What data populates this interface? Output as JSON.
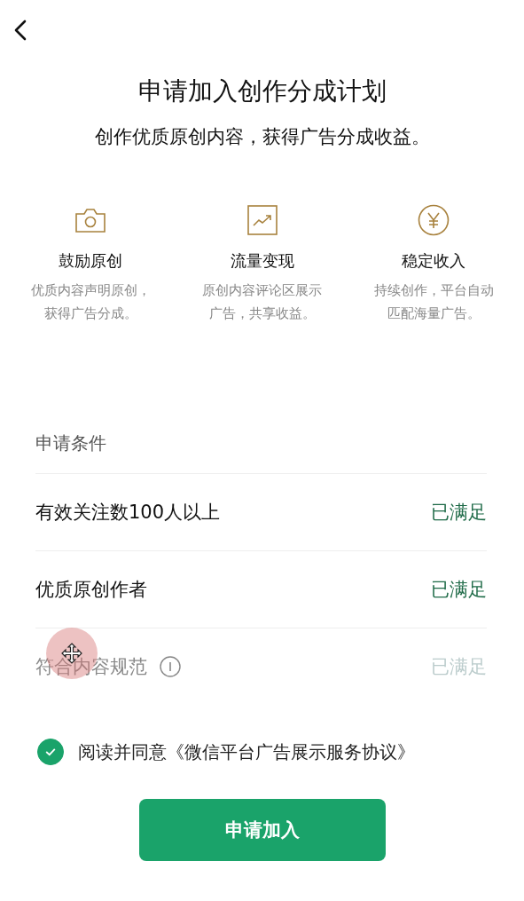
{
  "title": "申请加入创作分成计划",
  "subtitle": "创作优质原创内容，获得广告分成收益。",
  "features": [
    {
      "kind": "camera",
      "title": "鼓励原创",
      "desc": "优质内容声明原创，获得广告分成。"
    },
    {
      "kind": "chart",
      "title": "流量变现",
      "desc": "原创内容评论区展示广告，共享收益。"
    },
    {
      "kind": "yen",
      "title": "稳定收入",
      "desc": "持续创作，平台自动匹配海量广告。"
    }
  ],
  "conditions": {
    "heading": "申请条件",
    "rows": [
      {
        "label": "有效关注数100人以上",
        "status": "已满足",
        "info": false,
        "dimmed": false
      },
      {
        "label": "优质原创作者",
        "status": "已满足",
        "info": false,
        "dimmed": false
      },
      {
        "label": "符合内容规范",
        "status": "已满足",
        "info": true,
        "dimmed": true
      }
    ]
  },
  "agreement": {
    "checked": true,
    "text": "阅读并同意《微信平台广告展示服务协议》"
  },
  "button": "申请加入"
}
